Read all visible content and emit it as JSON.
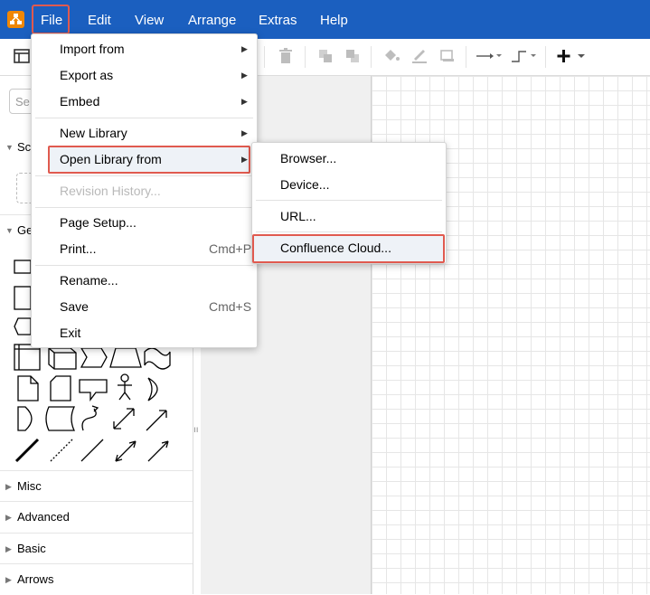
{
  "menubar": {
    "items": [
      "File",
      "Edit",
      "View",
      "Arrange",
      "Extras",
      "Help"
    ]
  },
  "sidebar": {
    "search_placeholder": "Se",
    "sections": [
      "Sc",
      "Ge",
      "Misc",
      "Advanced",
      "Basic",
      "Arrows"
    ]
  },
  "file_menu": {
    "items": [
      {
        "label": "Import from",
        "submenu": true
      },
      {
        "label": "Export as",
        "submenu": true
      },
      {
        "label": "Embed",
        "submenu": true
      },
      {
        "label": "New Library",
        "submenu": true
      },
      {
        "label": "Open Library from",
        "submenu": true,
        "highlighted": true
      },
      {
        "label": "Revision History...",
        "disabled": true
      },
      {
        "label": "Page Setup..."
      },
      {
        "label": "Print...",
        "shortcut": "Cmd+P"
      },
      {
        "label": "Rename..."
      },
      {
        "label": "Save",
        "shortcut": "Cmd+S"
      },
      {
        "label": "Exit"
      }
    ]
  },
  "library_submenu": {
    "items": [
      {
        "label": "Browser..."
      },
      {
        "label": "Device..."
      },
      {
        "label": "URL..."
      },
      {
        "label": "Confluence Cloud...",
        "highlighted": true
      }
    ]
  },
  "colors": {
    "menubar": "#1b5fbf",
    "highlight_border": "#e05a4f",
    "logo": "#f08705"
  }
}
